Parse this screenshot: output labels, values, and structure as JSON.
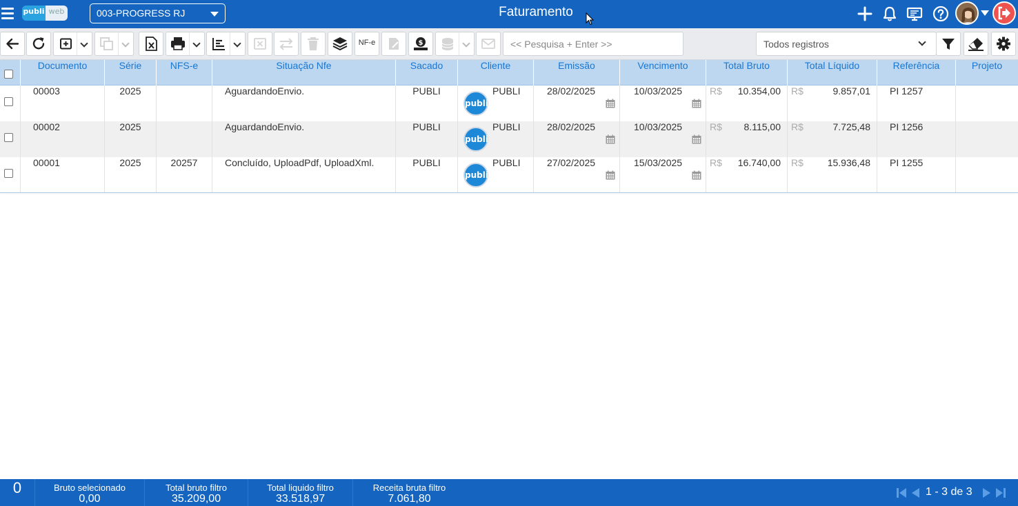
{
  "app": {
    "logo_left": "publi",
    "logo_right": "web",
    "company": "003-PROGRESS RJ",
    "title": "Faturamento"
  },
  "toolbar": {
    "nfe_label": "NF-e",
    "search_placeholder": "<< Pesquisa + Enter >>",
    "filter_value": "Todos registros"
  },
  "table": {
    "columns": [
      "Documento",
      "Série",
      "NFS-e",
      "Situação Nfe",
      "Sacado",
      "Cliente",
      "Emissão",
      "Vencimento",
      "Total Bruto",
      "Total Líquido",
      "Referência",
      "Projeto"
    ],
    "currency": "R$",
    "client_logo": "publi",
    "rows": [
      {
        "documento": "00003",
        "serie": "2025",
        "nfse": "",
        "situacao": "AguardandoEnvio.",
        "sacado": "PUBLI",
        "cliente": "PUBLI",
        "emissao": "28/02/2025",
        "vencimento": "10/03/2025",
        "total_bruto": "10.354,00",
        "total_liquido": "9.857,01",
        "referencia": "PI 1257",
        "projeto": ""
      },
      {
        "documento": "00002",
        "serie": "2025",
        "nfse": "",
        "situacao": "AguardandoEnvio.",
        "sacado": "PUBLI",
        "cliente": "PUBLI",
        "emissao": "28/02/2025",
        "vencimento": "10/03/2025",
        "total_bruto": "8.115,00",
        "total_liquido": "7.725,48",
        "referencia": "PI 1256",
        "projeto": ""
      },
      {
        "documento": "00001",
        "serie": "2025",
        "nfse": "20257",
        "situacao": "Concluído, UploadPdf, UploadXml.",
        "sacado": "PUBLI",
        "cliente": "PUBLI",
        "emissao": "27/02/2025",
        "vencimento": "15/03/2025",
        "total_bruto": "16.740,00",
        "total_liquido": "15.936,48",
        "referencia": "PI 1255",
        "projeto": ""
      }
    ]
  },
  "footer": {
    "selected_count": "0",
    "bruto_selecionado_label": "Bruto selecionado",
    "bruto_selecionado_value": "0,00",
    "total_bruto_label": "Total bruto filtro",
    "total_bruto_value": "35.209,00",
    "total_liquido_label": "Total liquido filtro",
    "total_liquido_value": "33.518,97",
    "receita_label": "Receita bruta filtro",
    "receita_value": "7.061,80",
    "pagination": "1 - 3 de 3"
  }
}
